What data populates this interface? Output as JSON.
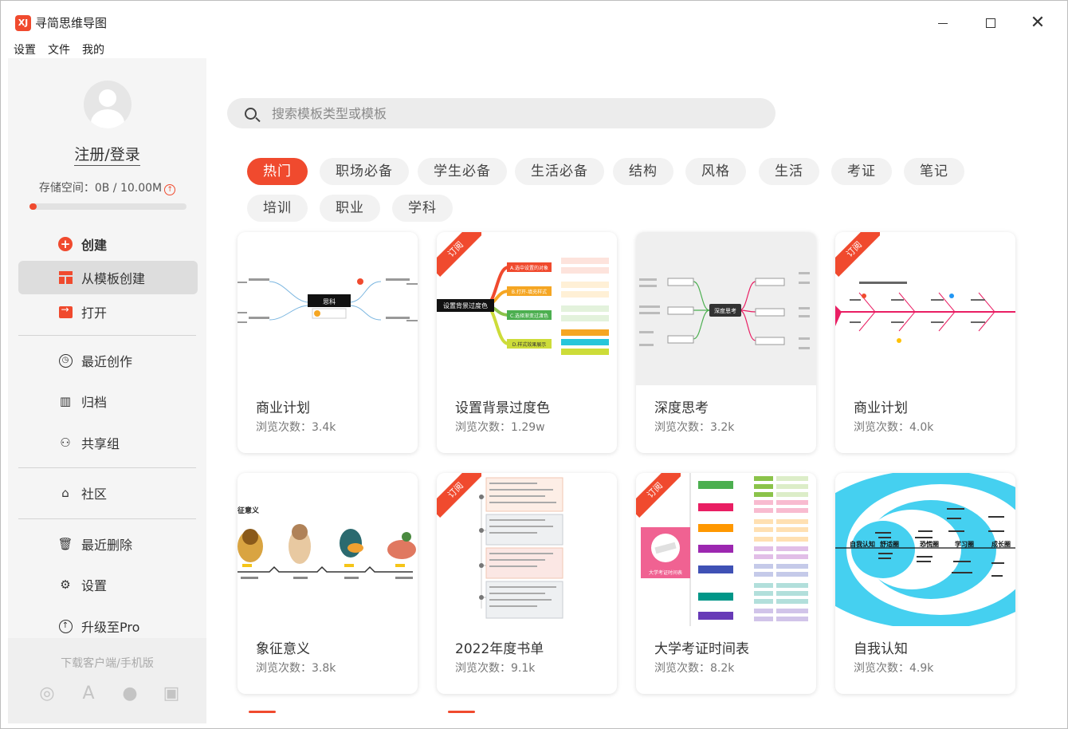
{
  "app": {
    "title": "寻简思维导图",
    "logo_text": "XJ"
  },
  "menu": [
    "设置",
    "文件",
    "我的"
  ],
  "sidebar": {
    "login": "注册/登录",
    "storage": "存储空间：0B / 10.00M",
    "storage_used_fraction": 0.0,
    "nav": [
      {
        "label": "创建",
        "icon": "plus-circle-icon"
      },
      {
        "label": "从模板创建",
        "icon": "template-icon"
      },
      {
        "label": "打开",
        "icon": "open-folder-icon"
      },
      {
        "label": "最近创作",
        "icon": "clock-icon"
      },
      {
        "label": "归档",
        "icon": "archive-icon"
      },
      {
        "label": "共享组",
        "icon": "share-group-icon"
      },
      {
        "label": "社区",
        "icon": "community-icon"
      },
      {
        "label": "最近删除",
        "icon": "trash-icon"
      },
      {
        "label": "设置",
        "icon": "gear-icon"
      },
      {
        "label": "升级至Pro",
        "icon": "upgrade-icon"
      }
    ],
    "download_label": "下载客户端/手机版"
  },
  "search": {
    "placeholder": "搜索模板类型或模板"
  },
  "tags": [
    "热门",
    "职场必备",
    "学生必备",
    "生活必备",
    "结构",
    "风格",
    "生活",
    "考证",
    "笔记",
    "培训",
    "职业",
    "学科"
  ],
  "active_tag": "热门",
  "cards": [
    {
      "title": "商业计划",
      "views": "浏览次数：3.4k",
      "ribbon": "",
      "thumb": "mindmap-business"
    },
    {
      "title": "设置背景过度色",
      "views": "浏览次数：1.29w",
      "ribbon": "订阅",
      "thumb": "mindmap-gradient"
    },
    {
      "title": "深度思考",
      "views": "浏览次数：3.2k",
      "ribbon": "",
      "thumb": "mindmap-deep"
    },
    {
      "title": "商业计划",
      "views": "浏览次数：4.0k",
      "ribbon": "订阅",
      "thumb": "fishbone"
    },
    {
      "title": "象征意义",
      "views": "浏览次数：3.8k",
      "ribbon": "",
      "thumb": "animals"
    },
    {
      "title": "2022年度书单",
      "views": "浏览次数：9.1k",
      "ribbon": "订阅",
      "thumb": "booklist"
    },
    {
      "title": "大学考证时间表",
      "views": "浏览次数：8.2k",
      "ribbon": "订阅",
      "thumb": "exam-timeline"
    },
    {
      "title": "自我认知",
      "views": "浏览次数：4.9k",
      "ribbon": "",
      "thumb": "circles"
    }
  ],
  "thumb_text": {
    "business_center": "思科",
    "gradient_center": "设置背景过度色",
    "gradient_nodes": [
      "A.选中设置的对象",
      "B.打开-填充样式",
      "C.选择渐变过渡色",
      "D.样式效果展示"
    ],
    "deep_center": "深度思考",
    "symbol_title": "征意义",
    "circles_labels": [
      "自我认知",
      "舒适圈",
      "恐慌圈",
      "学习圈",
      "成长圈"
    ],
    "exam_badge": "大学考证时间表"
  },
  "colors": {
    "accent": "#f04a2e",
    "sidebar_bg": "#f5f5f5",
    "active_nav": "#dddddd",
    "cyan": "#45d0f0"
  }
}
